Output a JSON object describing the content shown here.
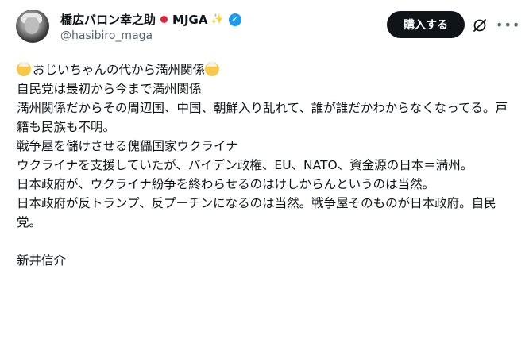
{
  "user": {
    "name": "橋広バロン幸之助",
    "badge": "MJGA",
    "handle": "@hasibiro_maga",
    "verified_color": "#1d9bf0",
    "icons": [
      "japan-flag-icon",
      "sparkle-icon",
      "verified-badge-icon"
    ]
  },
  "actions": {
    "buy_label": "購入する",
    "buy_bg": "#0f1419",
    "icons": [
      "grok-icon",
      "more-icon"
    ]
  },
  "post": {
    "line1_text": "おじいちゃんの代から満州関係",
    "line1_emoji": "older-person-emoji",
    "lines": [
      "自民党は最初から今まで満州関係",
      "満州関係だからその周辺国、中国、朝鮮入り乱れて、誰が誰だかわからなくなってる。戸籍も民族も不明。",
      "戦争屋を儲けさせる傀儡国家ウクライナ",
      "ウクライナを支援していたが、バイデン政権、EU、NATO、資金源の日本＝満州。",
      "日本政府が、ウクライナ紛争を終わらせるのはけしからんというのは当然。",
      "日本政府が反トランプ、反プーチンになるのは当然。戦争屋そのものが日本政府。自民党。"
    ],
    "signature": "新井信介"
  }
}
